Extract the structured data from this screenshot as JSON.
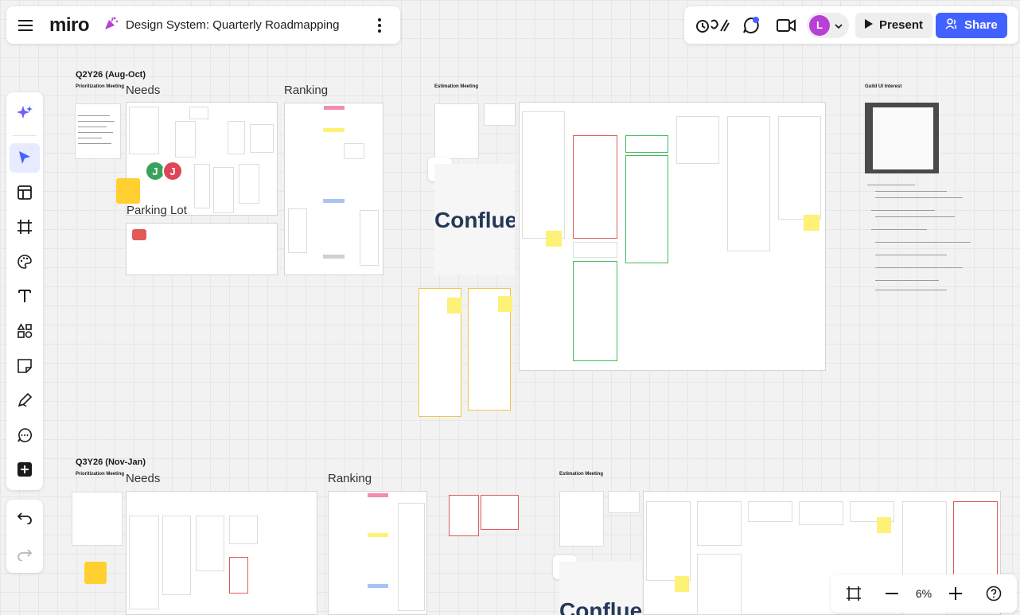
{
  "app": {
    "logo": "miro",
    "board_title": "Design System: Quarterly Roadmapping"
  },
  "topbar": {
    "present_label": "Present",
    "share_label": "Share",
    "user_initial": "L"
  },
  "zoom": {
    "value": "6%"
  },
  "canvas": {
    "q2_label": "Q2Y26 (Aug-Oct)",
    "q3_label": "Q3Y26 (Nov-Jan)",
    "prioritization_label": "Prioritization Meeting",
    "needs_label": "Needs",
    "ranking_label": "Ranking",
    "parking_lot_label": "Parking Lot",
    "estimation_label": "Estimation Meeting",
    "guild_label": "Guild UI Interest",
    "confluence_text": "Confluen",
    "cursor_j_green": "J",
    "cursor_j_red": "J"
  },
  "colors": {
    "accent": "#4262ff",
    "sticky": "#fdf178",
    "avatar": "#b93fd6"
  }
}
